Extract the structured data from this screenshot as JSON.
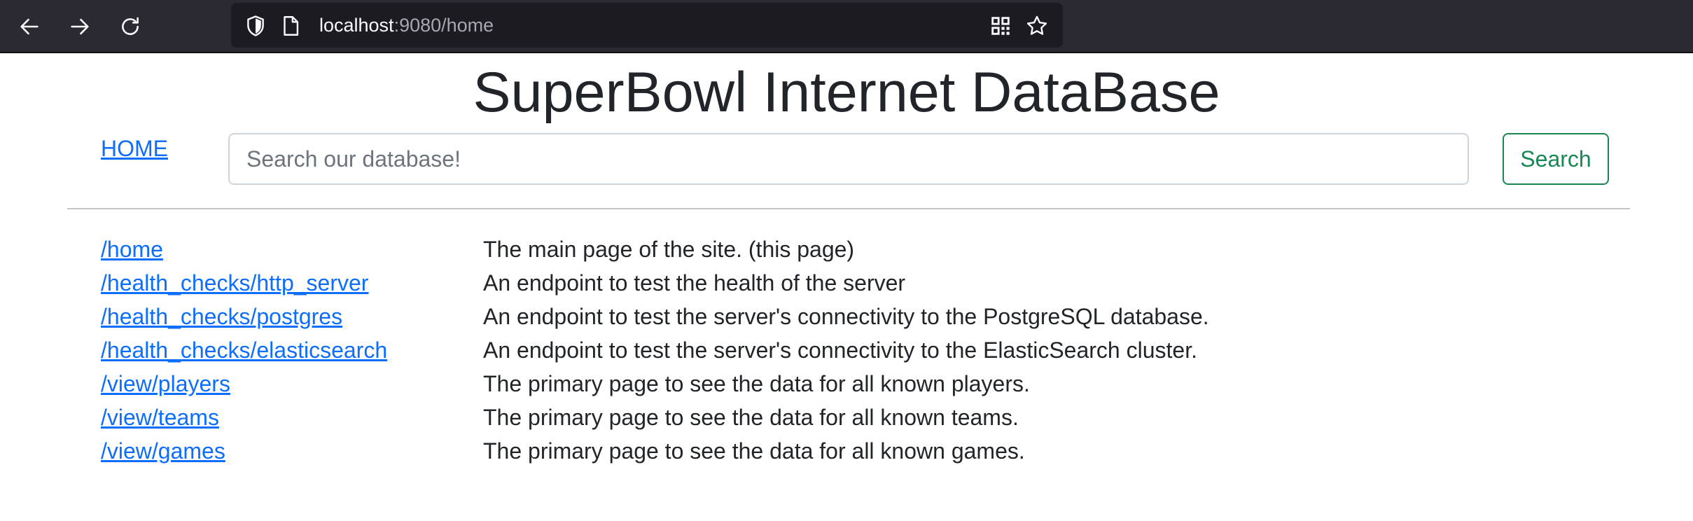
{
  "browser": {
    "url_host": "localhost",
    "url_rest": ":9080/home"
  },
  "header": {
    "title": "SuperBowl Internet DataBase",
    "home_link": "HOME",
    "search_placeholder": "Search our database!",
    "search_button": "Search"
  },
  "routes": [
    {
      "path": "/home",
      "description": "The main page of the site. (this page)"
    },
    {
      "path": "/health_checks/http_server",
      "description": "An endpoint to test the health of the server"
    },
    {
      "path": "/health_checks/postgres",
      "description": "An endpoint to test the server's connectivity to the PostgreSQL database."
    },
    {
      "path": "/health_checks/elasticsearch",
      "description": "An endpoint to test the server's connectivity to the ElasticSearch cluster."
    },
    {
      "path": "/view/players",
      "description": "The primary page to see the data for all known players."
    },
    {
      "path": "/view/teams",
      "description": "The primary page to see the data for all known teams."
    },
    {
      "path": "/view/games",
      "description": "The primary page to see the data for all known games."
    }
  ],
  "colors": {
    "link": "#0d6efd",
    "success": "#198754",
    "toolbar": "#2b2a33",
    "urlbar": "#1c1b22"
  }
}
